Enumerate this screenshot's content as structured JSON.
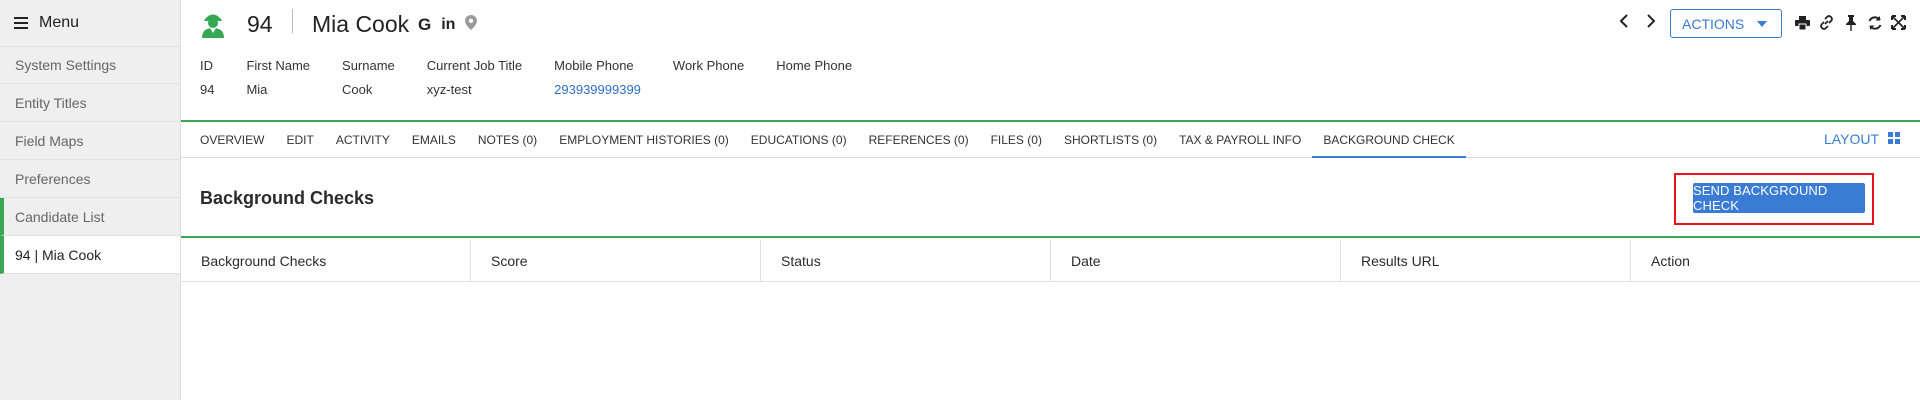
{
  "sidebar": {
    "menu_label": "Menu",
    "items": [
      {
        "label": "System Settings"
      },
      {
        "label": "Entity Titles"
      },
      {
        "label": "Field Maps"
      },
      {
        "label": "Preferences"
      },
      {
        "label": "Candidate List"
      },
      {
        "label": "94 | Mia Cook"
      }
    ]
  },
  "header": {
    "record_id": "94",
    "record_name": "Mia Cook",
    "social_google": "G",
    "social_linkedin": "in",
    "actions_label": "ACTIONS",
    "fields": [
      {
        "label": "ID",
        "value": "94"
      },
      {
        "label": "First Name",
        "value": "Mia"
      },
      {
        "label": "Surname",
        "value": "Cook"
      },
      {
        "label": "Current Job Title",
        "value": "xyz-test"
      },
      {
        "label": "Mobile Phone",
        "value": "293939999399"
      },
      {
        "label": "Work Phone",
        "value": ""
      },
      {
        "label": "Home Phone",
        "value": ""
      }
    ]
  },
  "tabs": [
    {
      "label": "OVERVIEW"
    },
    {
      "label": "EDIT"
    },
    {
      "label": "ACTIVITY"
    },
    {
      "label": "EMAILS"
    },
    {
      "label": "NOTES (0)"
    },
    {
      "label": "EMPLOYMENT HISTORIES (0)"
    },
    {
      "label": "EDUCATIONS (0)"
    },
    {
      "label": "REFERENCES (0)"
    },
    {
      "label": "FILES (0)"
    },
    {
      "label": "SHORTLISTS (0)"
    },
    {
      "label": "TAX & PAYROLL INFO"
    },
    {
      "label": "BACKGROUND CHECK"
    }
  ],
  "active_tab": "BACKGROUND CHECK",
  "layout_label": "LAYOUT",
  "section": {
    "title": "Background Checks",
    "send_button_label": "SEND BACKGROUND CHECK"
  },
  "table": {
    "columns": [
      "Background Checks",
      "Score",
      "Status",
      "Date",
      "Results URL",
      "Action"
    ]
  },
  "icons": {
    "menu": "hamburger-icon",
    "avatar": "person-worker-icon",
    "google": "google-icon",
    "linkedin": "linkedin-icon",
    "location": "map-pin-icon",
    "prev": "chevron-left-icon",
    "next": "chevron-right-icon",
    "print": "print-icon",
    "link": "link-icon",
    "pin": "pin-icon",
    "refresh": "refresh-icon",
    "expand": "expand-icon",
    "layout": "grid-icon"
  },
  "colors": {
    "accent_green": "#3aa757",
    "primary_blue": "#3a7bd5",
    "highlight_red": "#e8111c",
    "avatar_green": "#35a853"
  }
}
